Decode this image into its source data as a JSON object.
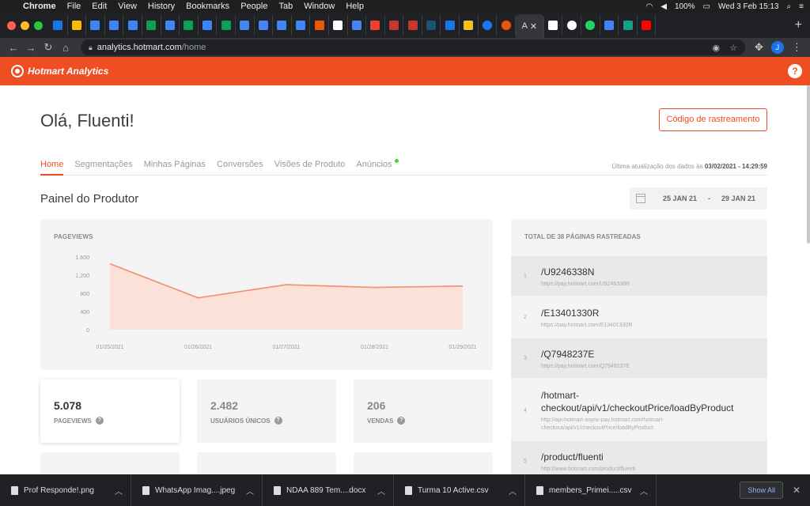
{
  "menubar": {
    "app": "Chrome",
    "items": [
      "File",
      "Edit",
      "View",
      "History",
      "Bookmarks",
      "People",
      "Tab",
      "Window",
      "Help"
    ],
    "battery": "100%",
    "clock": "Wed 3 Feb  15:13"
  },
  "tabs": {
    "active_label": "A"
  },
  "address": {
    "host": "analytics.hotmart.com",
    "path": "/home"
  },
  "app": {
    "brand": "Hotmart Analytics",
    "help": "?"
  },
  "greeting": "Olá, Fluenti!",
  "tracking_button": "Código de rastreamento",
  "nav_tabs": [
    "Home",
    "Segmentações",
    "Minhas Páginas",
    "Conversões",
    "Visões de Produto",
    "Anúncios"
  ],
  "last_update": {
    "prefix": "Última atualização dos dados às ",
    "value": "03/02/2021 - 14:29:59"
  },
  "section_title": "Painel do Produtor",
  "date_range": {
    "start": "25 JAN 21",
    "separator": "-",
    "end": "29 JAN 21"
  },
  "chart_card_label": "PAGEVIEWS",
  "chart_data": {
    "type": "area",
    "x": [
      "01/25/2021",
      "01/26/2021",
      "01/27/2021",
      "01/28/2021",
      "01/29/2021"
    ],
    "values": [
      1450,
      700,
      990,
      930,
      960
    ],
    "y_ticks": [
      "1,600",
      "1,200",
      "800",
      "400",
      "0"
    ],
    "ylim": [
      0,
      1600
    ],
    "color": "#f28f6e",
    "fill": "#fbe1d8"
  },
  "pages": {
    "title": "TOTAL DE 38 PÁGINAS RASTREADAS",
    "rows": [
      {
        "index": "1",
        "path": "/U9246338N",
        "url": "https://pay.hotmart.com/U9246338N"
      },
      {
        "index": "2",
        "path": "/E13401330R",
        "url": "https://pay.hotmart.com/E13401330R"
      },
      {
        "index": "3",
        "path": "/Q7948237E",
        "url": "https://pay.hotmart.com/Q7948237E"
      },
      {
        "index": "4",
        "path": "/hotmart-checkout/api/v1/checkoutPrice/loadByProduct",
        "url": "http://api-hotmart-async-pay.hotmart.com/hotmart-checkout/api/v1/checkoutPrice/loadByProduct"
      },
      {
        "index": "5",
        "path": "/product/fluenti",
        "url": "http://www.hotmart.com/product/fluenti"
      }
    ]
  },
  "stats": [
    {
      "value": "5.078",
      "label": "PAGEVIEWS"
    },
    {
      "value": "2.482",
      "label": "USUÁRIOS ÚNICOS"
    },
    {
      "value": "206",
      "label": "VENDAS"
    }
  ],
  "downloads": {
    "items": [
      "Prof Responde!.png",
      "WhatsApp Imag....jpeg",
      "NDAA 889 Tem....docx",
      "Turma 10 Active.csv",
      "members_Primei.....csv"
    ],
    "show_all": "Show All"
  }
}
